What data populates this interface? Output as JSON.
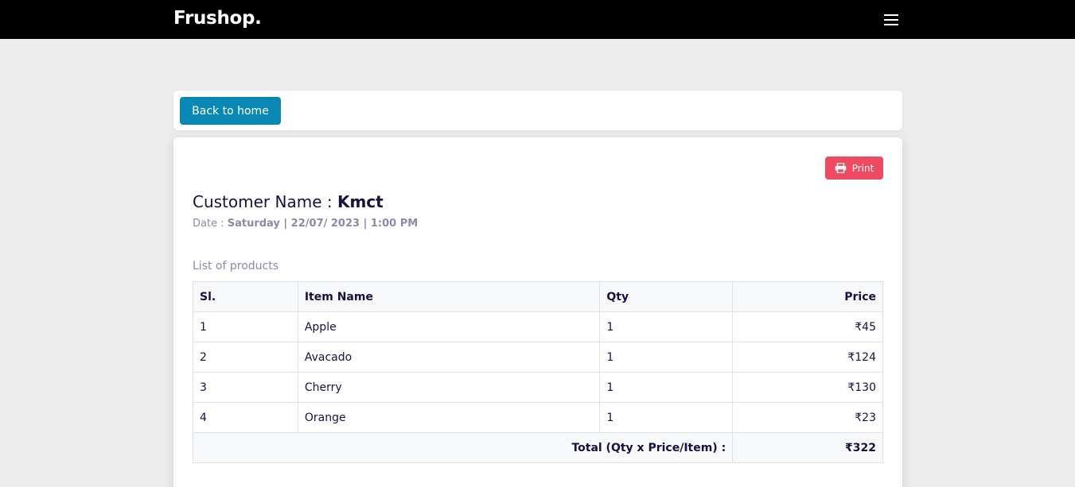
{
  "navbar": {
    "brand": "Frushop.",
    "menu_icon": "hamburger-menu-icon"
  },
  "top_card": {
    "back_label": "Back to home"
  },
  "invoice": {
    "print_label": "Print",
    "print_icon": "printer-icon",
    "customer_label": "Customer Name : ",
    "customer_name": "Kmct",
    "date_label": "Date : ",
    "date_value": "Saturday | 22/07/ 2023 | 1:00 PM",
    "list_title": "List of products",
    "columns": [
      "Sl.",
      "Item Name",
      "Qty",
      "Price"
    ],
    "rows": [
      {
        "sl": "1",
        "name": "Apple",
        "qty": "1",
        "price": "₹45"
      },
      {
        "sl": "2",
        "name": "Avacado",
        "qty": "1",
        "price": "₹124"
      },
      {
        "sl": "3",
        "name": "Cherry",
        "qty": "1",
        "price": "₹130"
      },
      {
        "sl": "4",
        "name": "Orange",
        "qty": "1",
        "price": "₹23"
      }
    ],
    "total_label": "Total (Qty x Price/Item) :",
    "total_value": "₹322"
  },
  "colors": {
    "navbar_bg": "#000000",
    "back_button": "#0a88b5",
    "print_button": "#ee4a62",
    "text_primary": "#1a1040",
    "text_muted": "#8b8aa8"
  }
}
